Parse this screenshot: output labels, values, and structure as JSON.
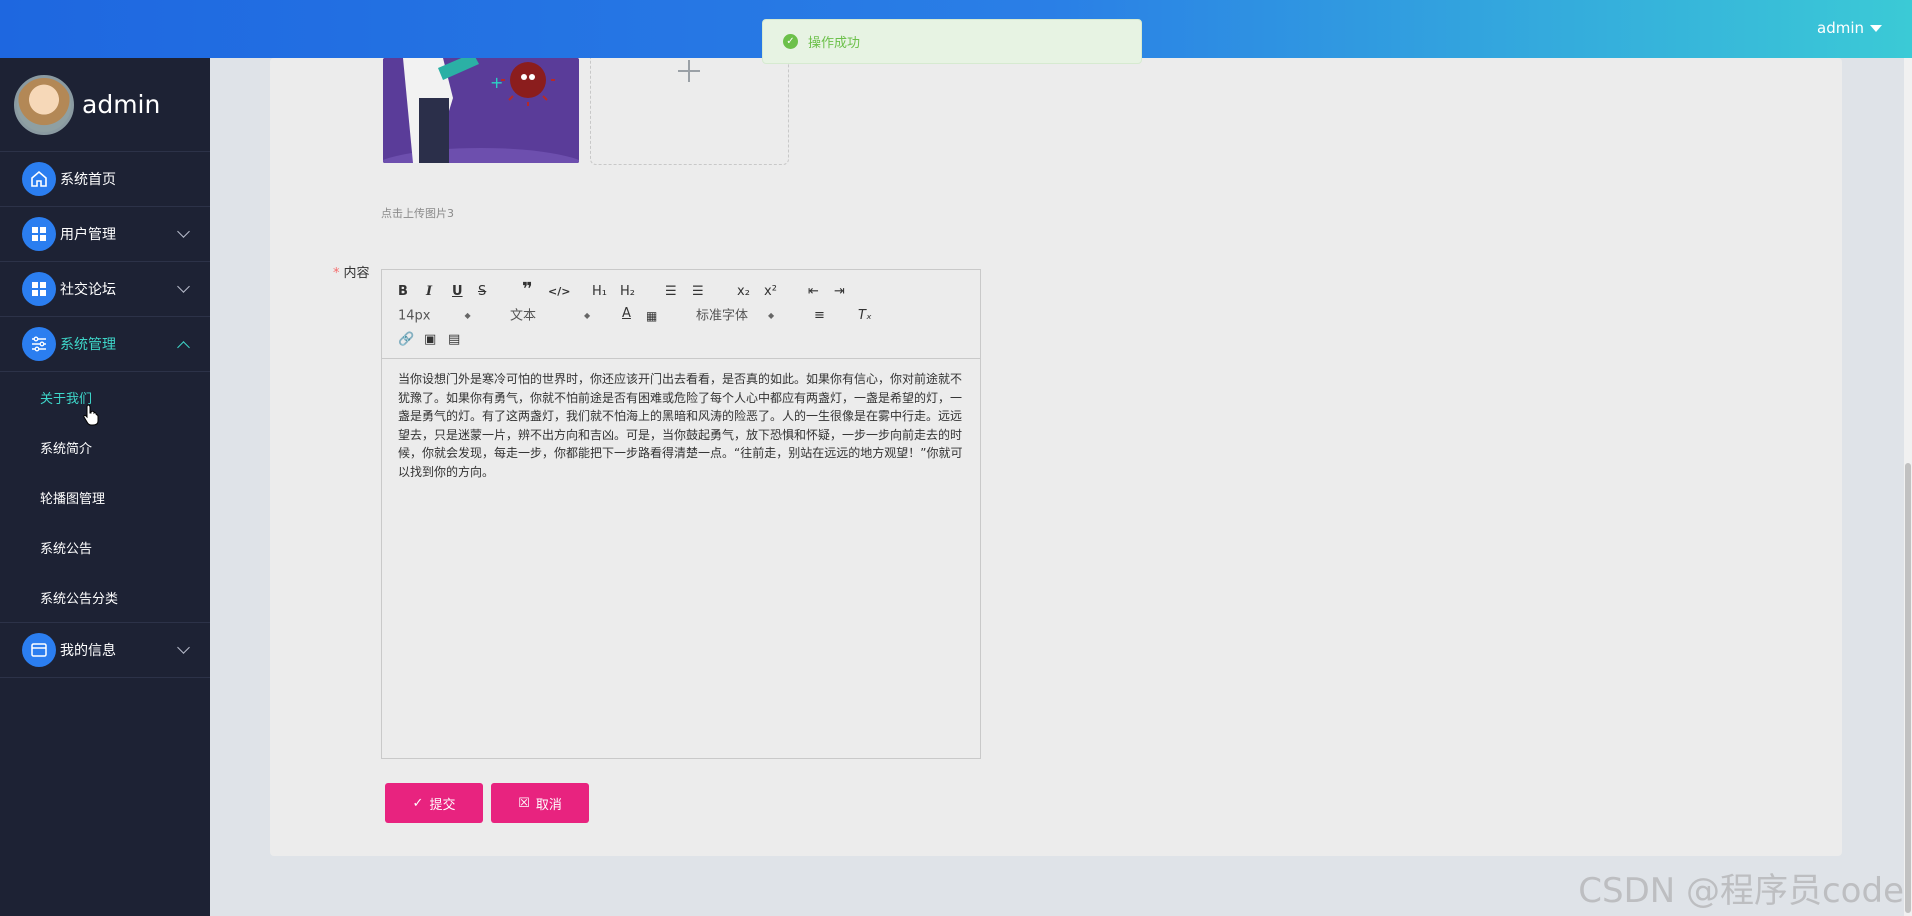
{
  "header": {
    "username": "admin"
  },
  "toast": {
    "message": "操作成功"
  },
  "sidebar": {
    "profile_name": "admin",
    "items": [
      {
        "label": "系统首页"
      },
      {
        "label": "用户管理"
      },
      {
        "label": "社交论坛"
      },
      {
        "label": "系统管理"
      },
      {
        "label": "我的信息"
      }
    ],
    "submenu": [
      {
        "label": "关于我们"
      },
      {
        "label": "系统简介"
      },
      {
        "label": "轮播图管理"
      },
      {
        "label": "系统公告"
      },
      {
        "label": "系统公告分类"
      }
    ]
  },
  "form": {
    "upload_tip": "点击上传图片3",
    "content_label": "内容",
    "required_mark": "*",
    "editor": {
      "font_size": "14px",
      "header_select": "文本",
      "font_family": "标准字体",
      "text": "当你设想门外是寒冷可怕的世界时，你还应该开门出去看看，是否真的如此。如果你有信心，你对前途就不犹豫了。如果你有勇气，你就不怕前途是否有困难或危险了每个人心中都应有两盏灯，一盏是希望的灯，一盏是勇气的灯。有了这两盏灯，我们就不怕海上的黑暗和风涛的险恶了。人的一生很像是在雾中行走。远远望去，只是迷蒙一片，辨不出方向和吉凶。可是，当你鼓起勇气，放下恐惧和怀疑，一步一步向前走去的时候，你就会发现，每走一步，你都能把下一步路看得清楚一点。“往前走，别站在远远的地方观望！”你就可以找到你的方向。"
    },
    "submit_label": "提交",
    "cancel_label": "取消"
  },
  "watermark": "CSDN @程序员code"
}
